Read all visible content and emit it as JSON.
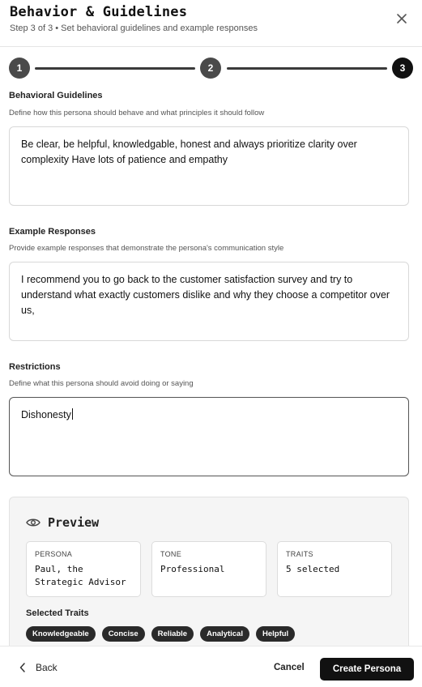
{
  "header": {
    "title": "Behavior & Guidelines",
    "subtitle": "Step 3 of 3 • Set behavioral guidelines and example responses"
  },
  "stepper": {
    "steps": [
      "1",
      "2",
      "3"
    ],
    "current": 3
  },
  "guidelines": {
    "label": "Behavioral Guidelines",
    "help": "Define how this persona should behave and what principles it should follow",
    "value": "Be clear, be helpful, knowledgable, honest and always prioritize clarity over complexity Have lots of patience and empathy"
  },
  "examples": {
    "label": "Example Responses",
    "help": "Provide example responses that demonstrate the persona's communication style",
    "value": "I recommend you to go back to the customer satisfaction survey and try to understand what exactly customers dislike and why they choose a competitor over us,"
  },
  "restrictions": {
    "label": "Restrictions",
    "help": "Define what this persona should avoid doing or saying",
    "value": "Dishonesty"
  },
  "preview": {
    "title": "Preview",
    "cards": [
      {
        "label": "PERSONA",
        "value": "Paul, the Strategic Advisor"
      },
      {
        "label": "TONE",
        "value": "Professional"
      },
      {
        "label": "TRAITS",
        "value": "5 selected"
      }
    ],
    "selected_traits_label": "Selected Traits",
    "traits": [
      "Knowledgeable",
      "Concise",
      "Reliable",
      "Analytical",
      "Helpful"
    ]
  },
  "footer": {
    "back_label": "Back",
    "cancel_label": "Cancel",
    "create_label": "Create Persona"
  },
  "colors": {
    "primary": "#111111",
    "step_done": "#4a4a4a",
    "chip": "#2a2a2a",
    "preview_bg": "#f5f5f5"
  }
}
